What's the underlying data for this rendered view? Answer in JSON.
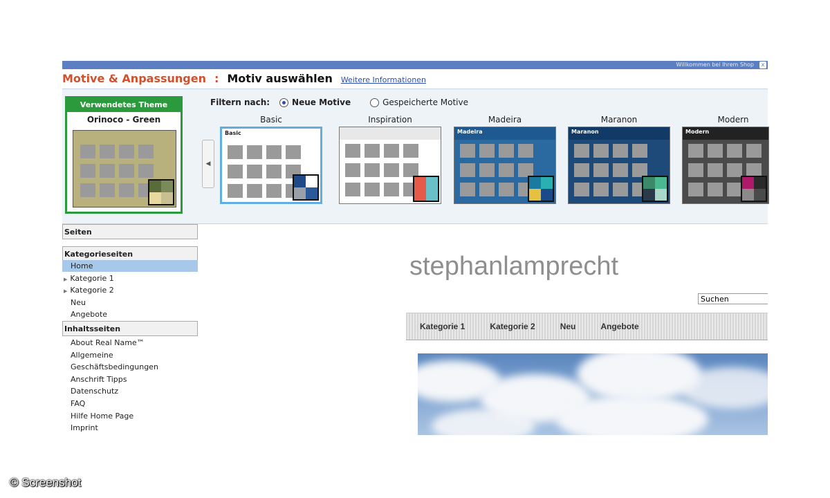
{
  "topbar": {
    "text": "Willkommen bei Ihrem Shop",
    "close": "x"
  },
  "title": {
    "main": "Motive & Anpassungen",
    "colon": ":",
    "sub": "Motiv auswählen",
    "link": "Weitere Informationen"
  },
  "current_theme": {
    "header": "Verwendetes Theme",
    "name": "Orinoco - Green",
    "colors": [
      "#5a6b3a",
      "#7a8a5a",
      "#e8d9a0",
      "#c8c090"
    ]
  },
  "filter": {
    "label": "Filtern nach:",
    "options": [
      {
        "label": "Neue Motive",
        "selected": true
      },
      {
        "label": "Gespeicherte Motive",
        "selected": false
      }
    ]
  },
  "themes": [
    {
      "name": "Basic",
      "header_text": "Basic",
      "selected": true,
      "bg": "#ffffff",
      "header_color": "#ffffff",
      "swatch": [
        "#1f4a8a",
        "#ffffff",
        "#9aa0a8",
        "#2a5a9a"
      ]
    },
    {
      "name": "Inspiration",
      "header_text": "",
      "selected": false,
      "bg": "#ffffff",
      "header_color": "#e8e8e8",
      "swatch": [
        "#e65a4a",
        "#6ac0c8",
        "#e65a4a",
        "#6ac0c8"
      ]
    },
    {
      "name": "Madeira",
      "header_text": "Madeira",
      "selected": false,
      "bg": "#2a6aa0",
      "header_color": "#1e5a90",
      "swatch": [
        "#1a7aa0",
        "#2ab0b0",
        "#e8c040",
        "#1a4a8a"
      ]
    },
    {
      "name": "Maranon",
      "header_text": "Maranon",
      "selected": false,
      "bg": "#1e4a7a",
      "header_color": "#123a66",
      "swatch": [
        "#3a8a6a",
        "#4ab890",
        "#2a3a4a",
        "#a8d8c8"
      ]
    },
    {
      "name": "Modern",
      "header_text": "Modern",
      "selected": false,
      "bg": "#4a4a4a",
      "header_color": "#222222",
      "swatch": [
        "#b0186a",
        "#2a2a2a",
        "#8a8a8a",
        "#4a4a4a"
      ]
    }
  ],
  "nav": {
    "seiten": "Seiten",
    "kategorieseiten": "Kategorieseiten",
    "kategorie_items": [
      {
        "label": "Home",
        "active": true,
        "expandable": false
      },
      {
        "label": "Kategorie 1",
        "active": false,
        "expandable": true
      },
      {
        "label": "Kategorie 2",
        "active": false,
        "expandable": true
      },
      {
        "label": "Neu",
        "active": false,
        "expandable": false
      },
      {
        "label": "Angebote",
        "active": false,
        "expandable": false
      }
    ],
    "inhaltsseiten": "Inhaltsseiten",
    "inhalt_items": [
      "About Real Name™",
      "Allgemeine",
      "Geschäftsbedingungen",
      "Anschrift Tipps",
      "Datenschutz",
      "FAQ",
      "Hilfe Home Page",
      "Imprint"
    ]
  },
  "preview": {
    "site_title": "stephanlamprecht",
    "search_value": "Suchen",
    "nav_links": [
      "Kategorie 1",
      "Kategorie 2",
      "Neu",
      "Angebote"
    ]
  },
  "watermark": "© Screenshot"
}
